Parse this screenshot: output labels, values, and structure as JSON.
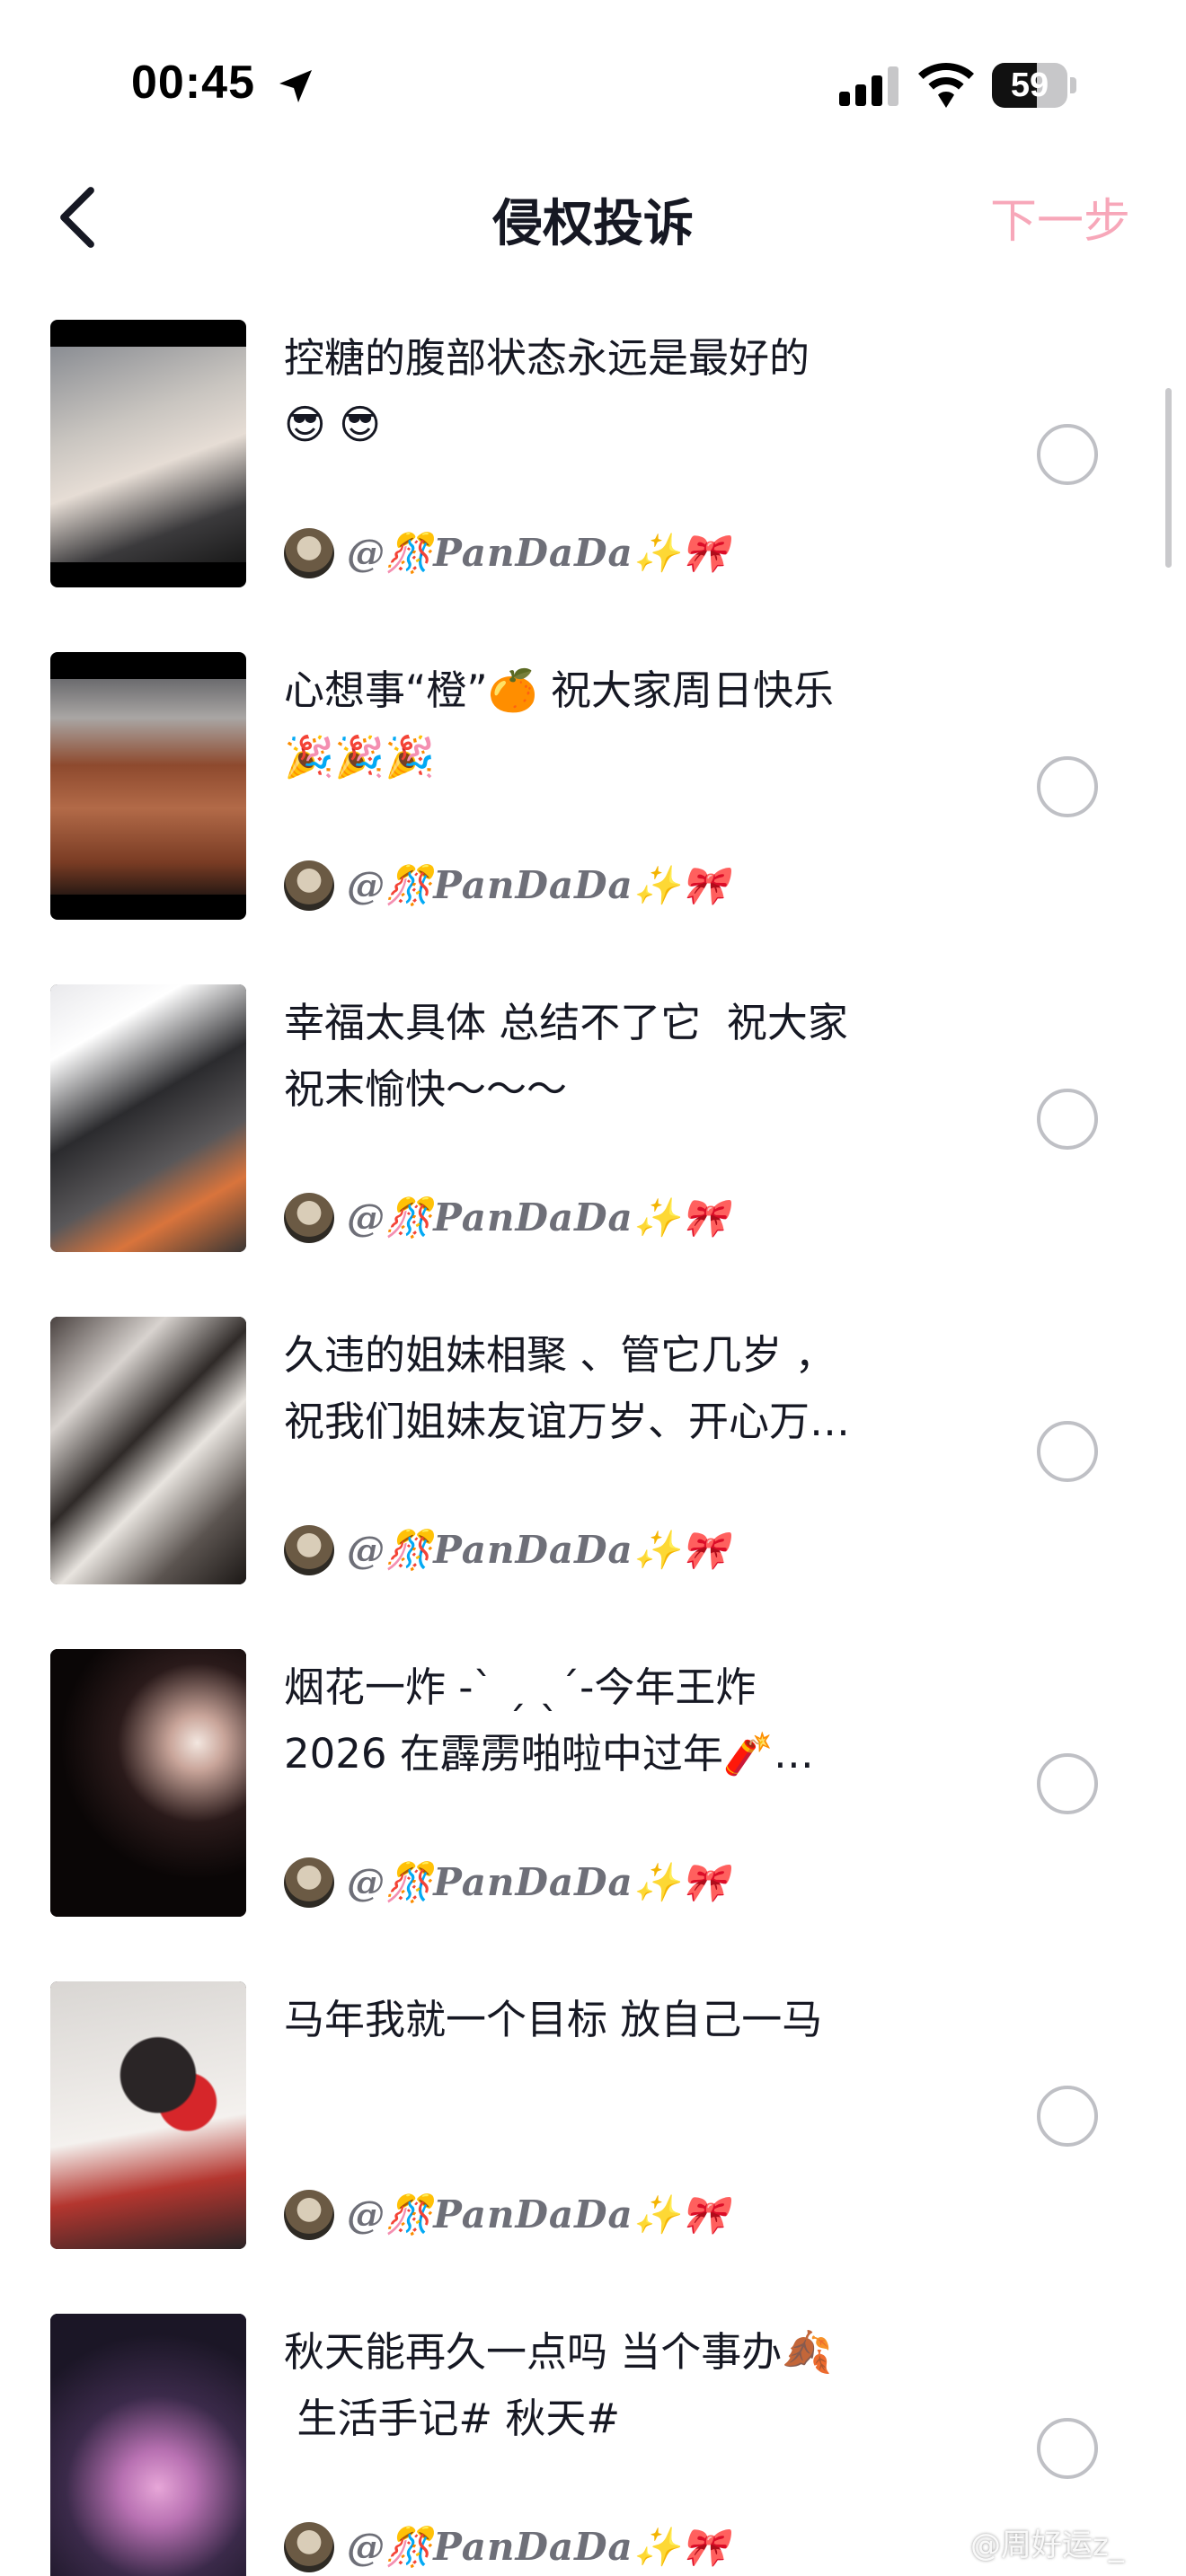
{
  "status_bar": {
    "time": "00:45",
    "battery_text": "59",
    "battery_level": 0.59,
    "icons": [
      "location-arrow-icon",
      "cellular-signal-icon",
      "wifi-icon",
      "battery-icon"
    ]
  },
  "nav": {
    "title": "侵权投诉",
    "next_label": "下一步",
    "back_icon": "chevron-left-icon",
    "next_color": "#f7a7b9"
  },
  "colors": {
    "title_text": "#161823",
    "author_text": "#6e6f78",
    "radio_border": "#bfc0c5"
  },
  "videos": [
    {
      "caption": "控糖的腹部状态永远是最好的\n😎 😎",
      "author": "@🎊PanDaDa✨🎀",
      "selected": false
    },
    {
      "caption": "心想事“橙”🍊 祝大家周日快乐\n🎉🎉🎉",
      "author": "@🎊PanDaDa✨🎀",
      "selected": false
    },
    {
      "caption": "幸福太具体 总结不了它  祝大家\n祝末愉快～～～",
      "author": "@🎊PanDaDa✨🎀",
      "selected": false
    },
    {
      "caption": "久违的姐妹相聚 、管它几岁 ，\n祝我们姐妹友谊万岁、开心万…",
      "author": "@🎊PanDaDa✨🎀",
      "selected": false
    },
    {
      "caption": "烟花一炸 -ˋ ˏ ˎˊ-今年王炸\n2026 在霹雳啪啦中过年🧨…",
      "author": "@🎊PanDaDa✨🎀",
      "selected": false
    },
    {
      "caption": "马年我就一个目标 放自己一马",
      "author": "@🎊PanDaDa✨🎀",
      "selected": false
    },
    {
      "caption": "秋天能再久一点吗 当个事办🍂\n 生活手记# 秋天#",
      "author": "@🎊PanDaDa✨🎀",
      "selected": false
    }
  ],
  "watermark": "@周好运z_"
}
